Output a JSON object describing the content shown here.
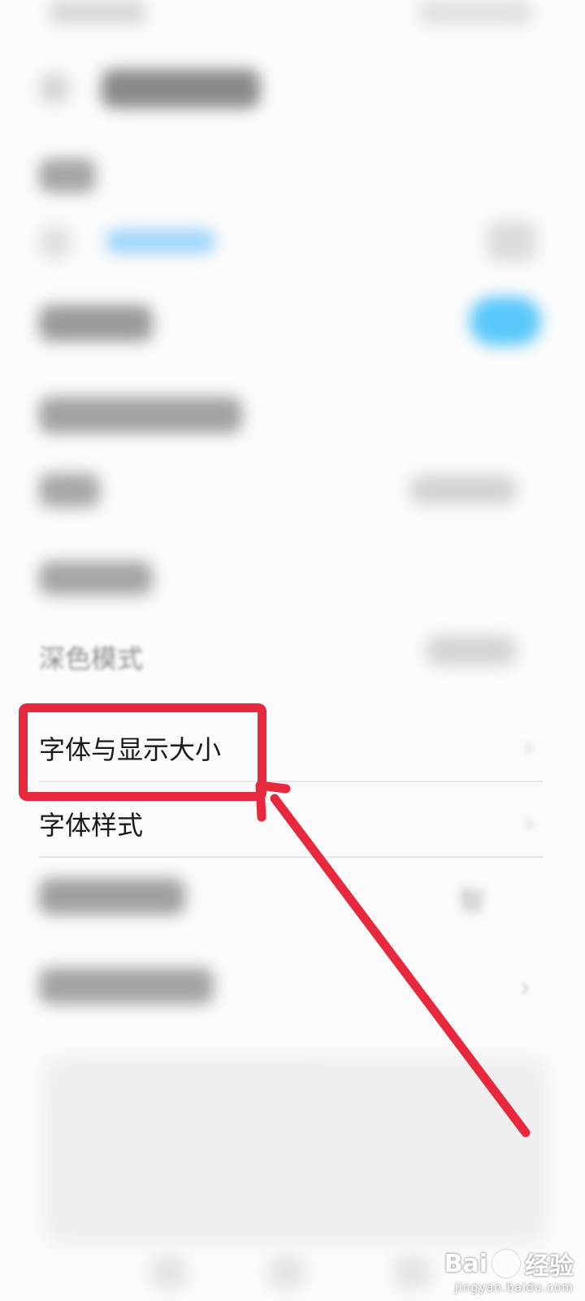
{
  "settings": {
    "blurred_item_dark_mode": "深色模式",
    "font_and_display_size": "字体与显示大小",
    "font_style": "字体样式",
    "blurred_value_smart": "智"
  },
  "colors": {
    "accent": "#5ac8fa",
    "highlight": "#e8283d",
    "background": "#fbfbfb"
  },
  "watermark": {
    "brand": "Bai",
    "brand_cn": "经验",
    "url": "jingyan.baidu.com"
  }
}
